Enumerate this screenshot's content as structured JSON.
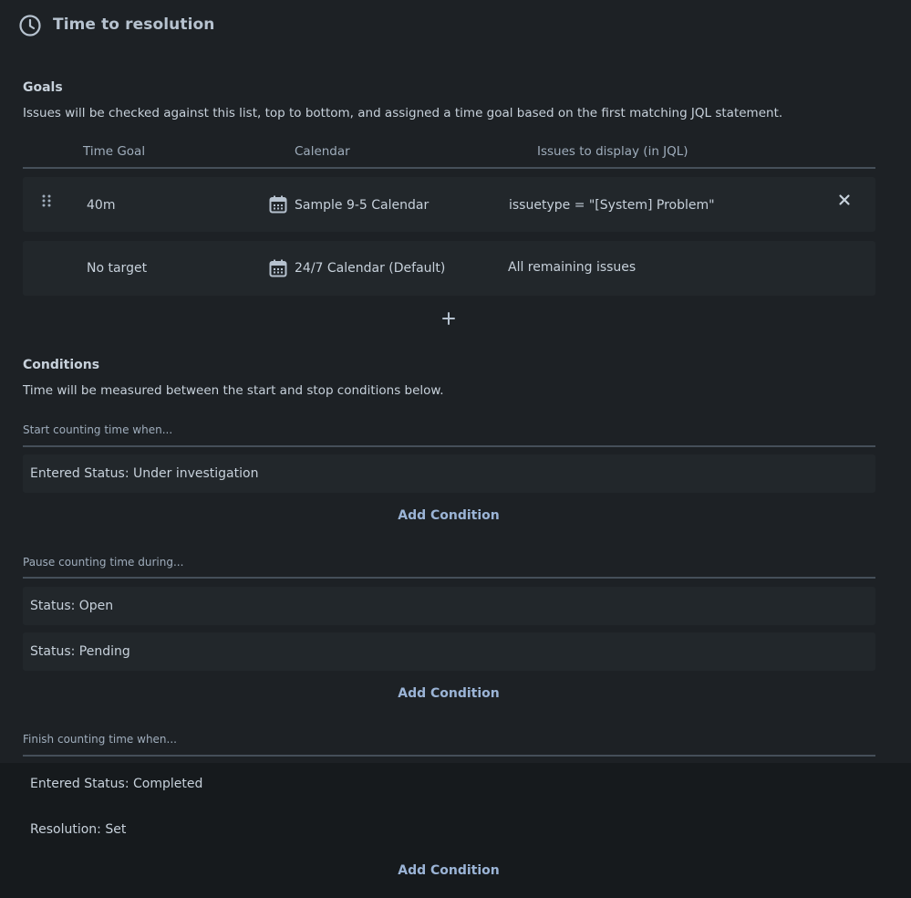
{
  "header": {
    "title": "Time to resolution",
    "icon": "clock-icon"
  },
  "goals": {
    "title": "Goals",
    "description": "Issues will be checked against this list, top to bottom, and assigned a time goal based on the first matching JQL statement.",
    "columns": [
      "Time Goal",
      "Calendar",
      "Issues to display (in JQL)"
    ],
    "rows": [
      {
        "time_goal": "40m",
        "calendar": "Sample 9-5 Calendar",
        "jql": "issuetype = \"[System] Problem\""
      },
      {
        "time_goal": "No target",
        "calendar": "24/7 Calendar (Default)",
        "jql": "All remaining issues"
      }
    ]
  },
  "conditions": {
    "title": "Conditions",
    "description": "Time will be measured between the start and stop conditions below.",
    "start": {
      "label": "Start counting time when...",
      "items": [
        "Entered Status: Under investigation"
      ]
    },
    "pause": {
      "label": "Pause counting time during...",
      "items": [
        "Status: Open",
        "Status: Pending"
      ]
    },
    "finish": {
      "label": "Finish counting time when...",
      "items": [
        "Entered Status: Completed",
        "Resolution: Set"
      ]
    },
    "add_label": "Add Condition"
  },
  "colors": {
    "background": "#1d2125",
    "row": "#22272b",
    "accent": "#9bb4d6",
    "divider": "#454f59"
  }
}
